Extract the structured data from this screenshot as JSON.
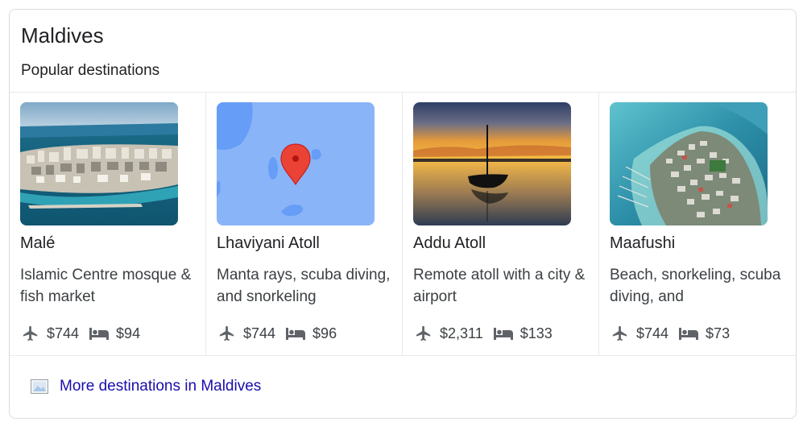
{
  "panel": {
    "title": "Maldives",
    "subtitle": "Popular destinations",
    "more_link": "More destinations in Maldives"
  },
  "cards": [
    {
      "name": "Malé",
      "description": "Islamic Centre mosque & fish market",
      "flight_price": "$744",
      "hotel_price": "$94",
      "image": "city-aerial-photo"
    },
    {
      "name": "Lhaviyani Atoll",
      "description": "Manta rays, scuba diving, and snorkeling",
      "flight_price": "$744",
      "hotel_price": "$96",
      "image": "map-pin-thumbnail"
    },
    {
      "name": "Addu Atoll",
      "description": "Remote atoll with a city & airport",
      "flight_price": "$2,311",
      "hotel_price": "$133",
      "image": "sunset-boat-photo"
    },
    {
      "name": "Maafushi",
      "description": "Beach, snorkeling, scuba diving, and",
      "flight_price": "$744",
      "hotel_price": "$73",
      "image": "island-aerial-photo"
    }
  ],
  "icons": {
    "flight": "flight-icon",
    "hotel": "hotel-bed-icon",
    "more": "image-icon"
  },
  "colors": {
    "link": "#1a0dab",
    "text": "#202124",
    "secondary_text": "#3c4043",
    "icon": "#5f6368",
    "map_pin": "#ea4335",
    "map_water": "#8ab4f8"
  }
}
